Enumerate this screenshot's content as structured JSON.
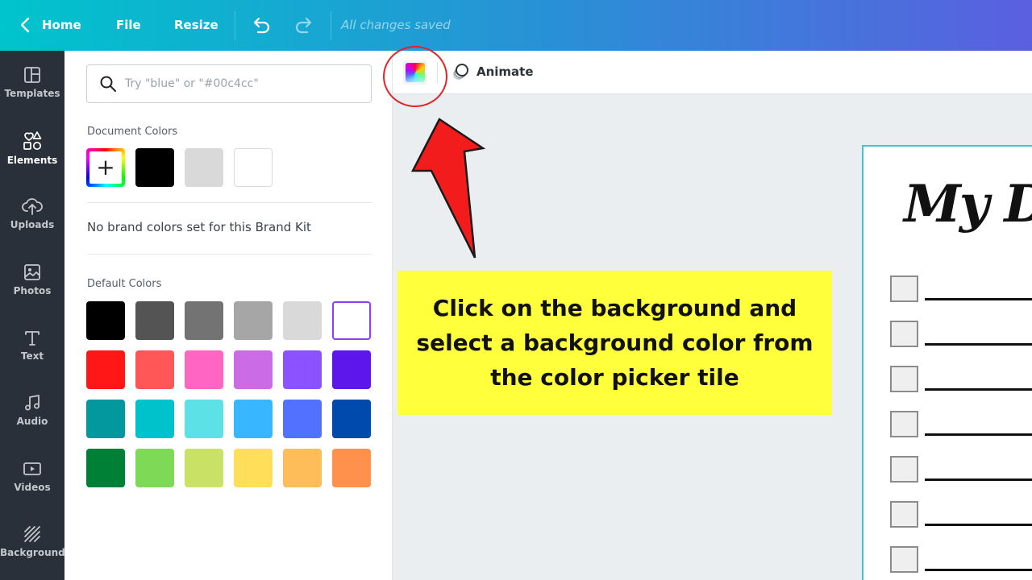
{
  "topbar": {
    "home_label": "Home",
    "file_label": "File",
    "resize_label": "Resize",
    "save_status": "All changes saved"
  },
  "leftnav": {
    "items": [
      {
        "label": "Templates",
        "icon": "templates-icon"
      },
      {
        "label": "Elements",
        "icon": "elements-icon",
        "active": true
      },
      {
        "label": "Uploads",
        "icon": "uploads-icon"
      },
      {
        "label": "Photos",
        "icon": "photos-icon"
      },
      {
        "label": "Text",
        "icon": "text-icon"
      },
      {
        "label": "Audio",
        "icon": "audio-icon"
      },
      {
        "label": "Videos",
        "icon": "videos-icon"
      },
      {
        "label": "Background",
        "icon": "background-icon"
      }
    ]
  },
  "color_panel": {
    "search_placeholder": "Try \"blue\" or \"#00c4cc\"",
    "document_colors_title": "Document Colors",
    "document_colors": [
      "#000000",
      "#d9d9d9",
      "#ffffff"
    ],
    "brand_note": "No brand colors set for this Brand Kit",
    "default_colors_title": "Default Colors",
    "default_colors": [
      [
        "#000000",
        "#545454",
        "#737373",
        "#a6a6a6",
        "#d9d9d9",
        "#ffffff"
      ],
      [
        "#ff1616",
        "#ff5757",
        "#ff66c4",
        "#cb6ce6",
        "#8c52ff",
        "#5e17eb"
      ],
      [
        "#03989e",
        "#00c2cb",
        "#5ce1e6",
        "#38b6ff",
        "#5271ff",
        "#004aad"
      ],
      [
        "#008037",
        "#7ed957",
        "#c9e265",
        "#ffde59",
        "#ffbd59",
        "#ff914d"
      ]
    ],
    "selected_default": "#ffffff"
  },
  "toolbar": {
    "animate_label": "Animate"
  },
  "annotation": {
    "callout_text": "Click on the background and select a background color from the color picker tile",
    "callout_color": "#ffff3c",
    "highlight_color": "#e0242a"
  },
  "canvas": {
    "page_title": "My Da",
    "checklist_rows": 7,
    "border_color": "#3ec7cf"
  }
}
